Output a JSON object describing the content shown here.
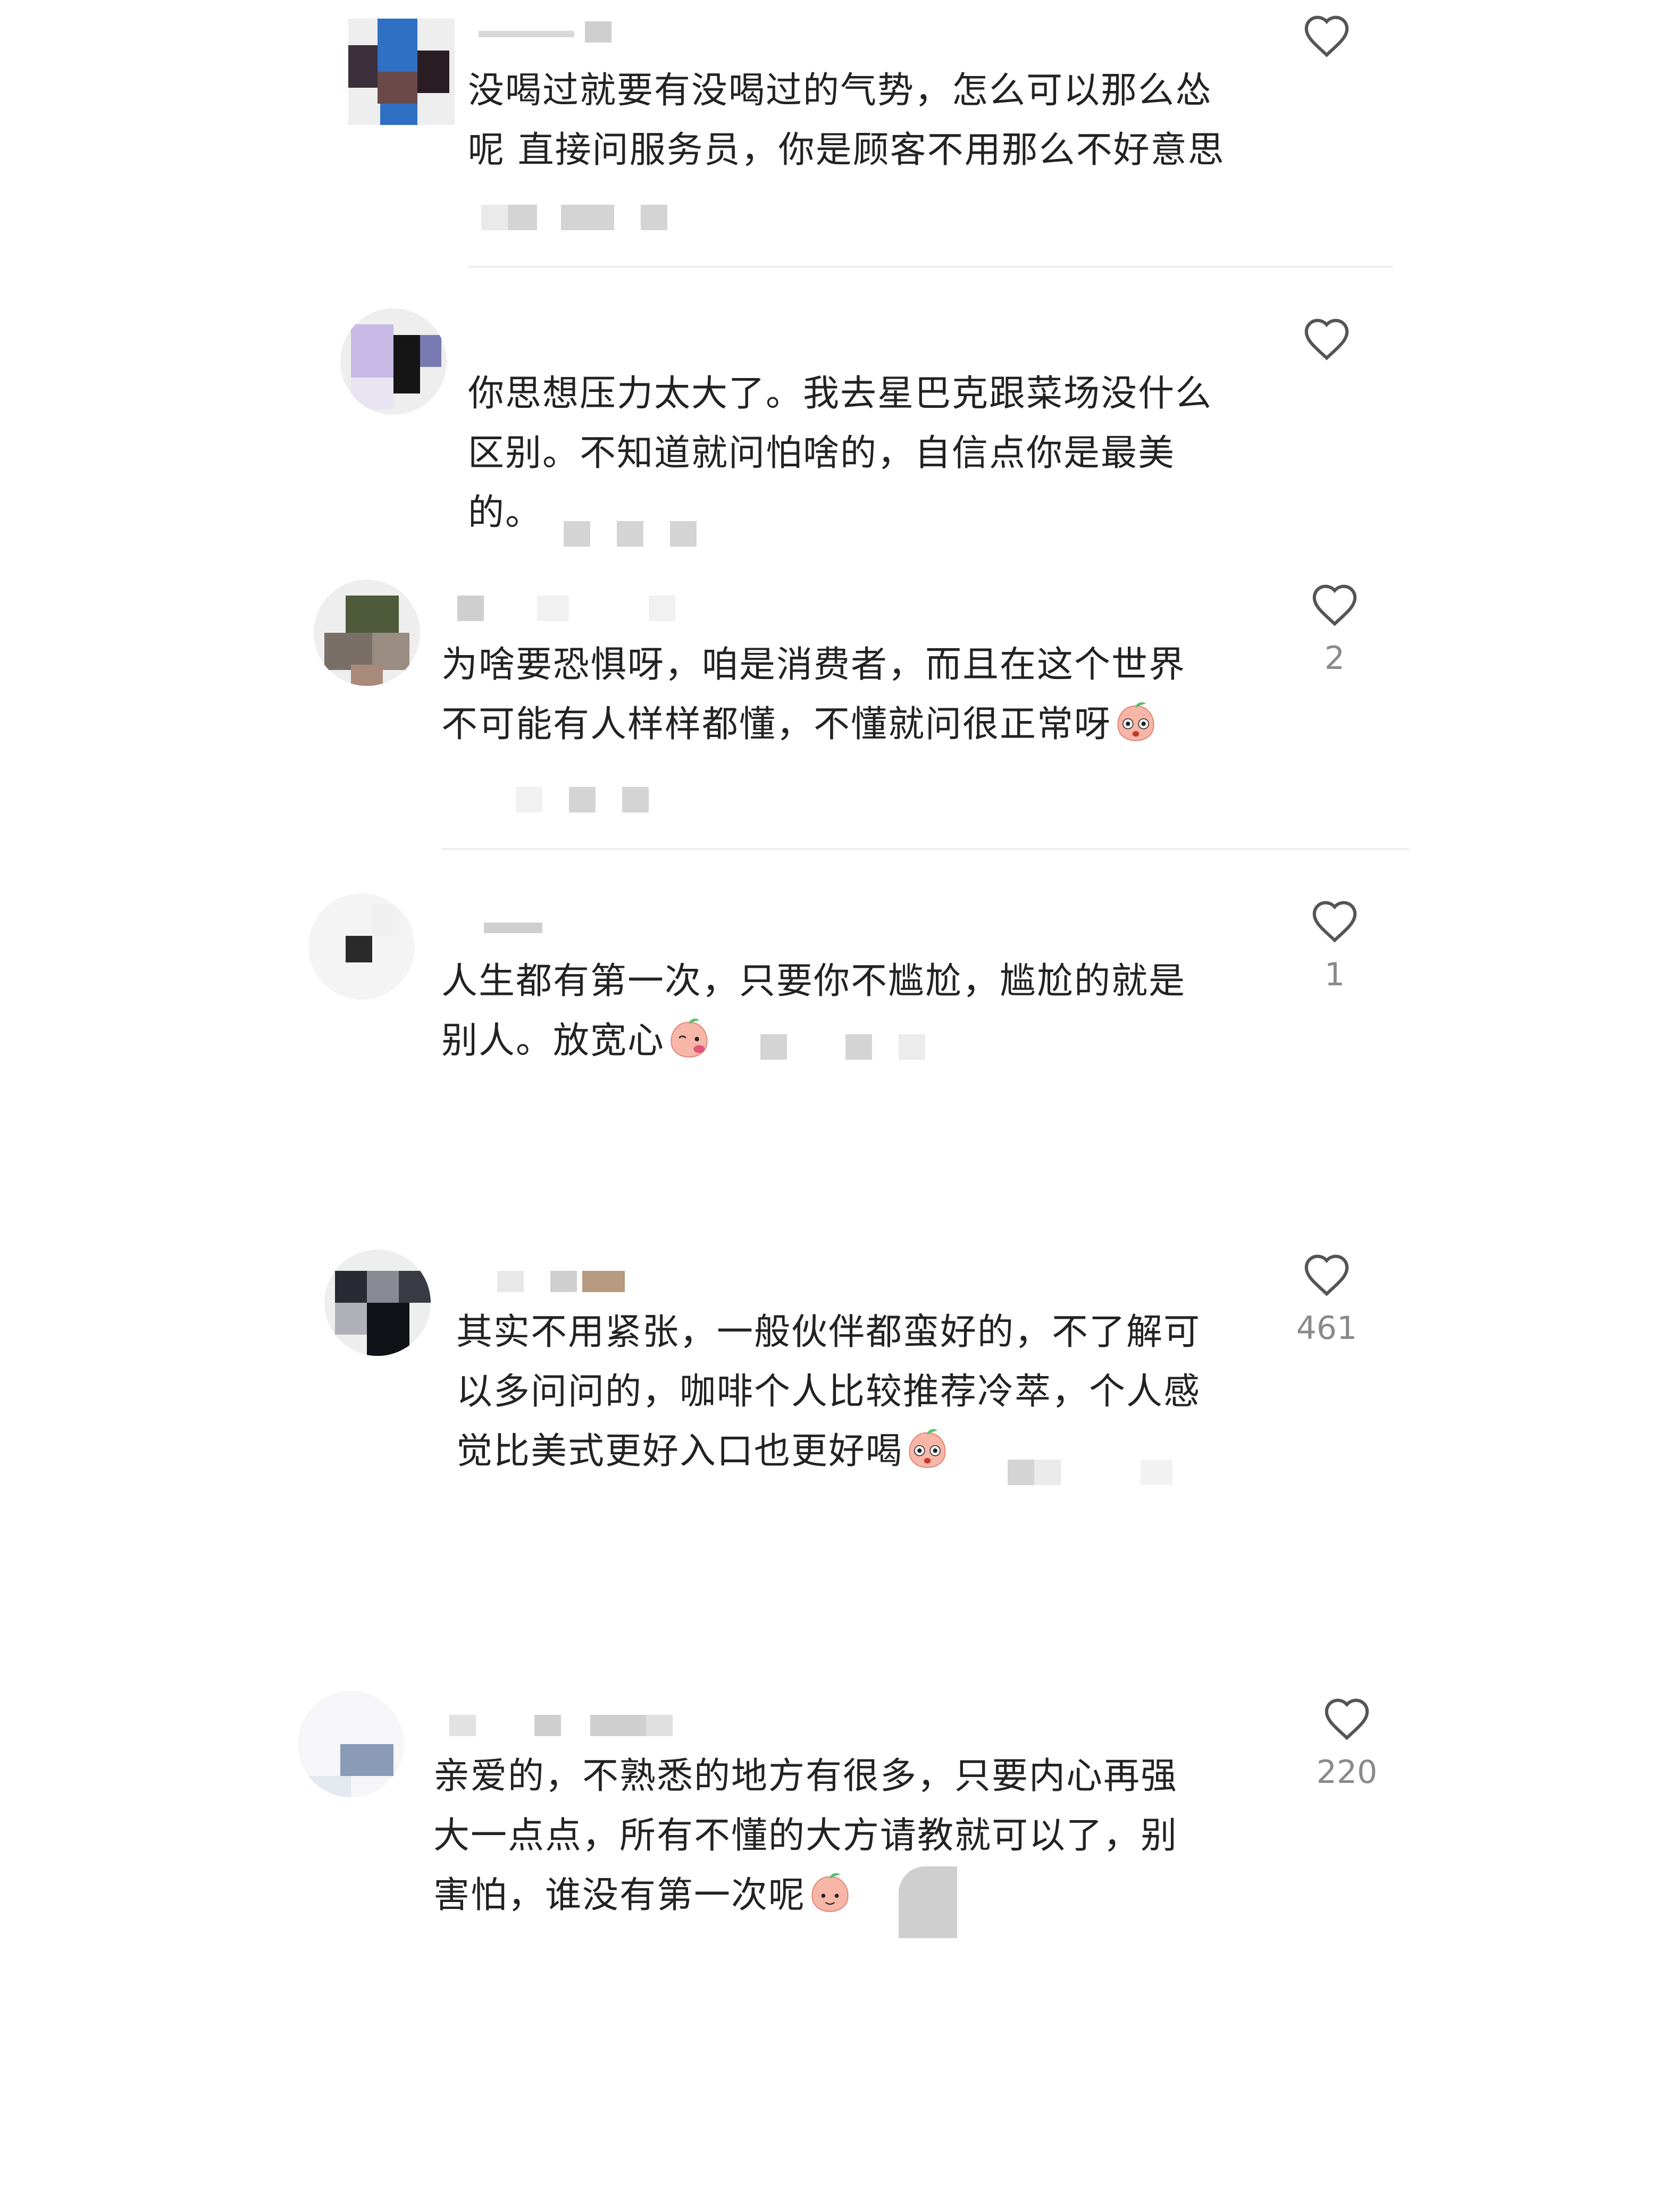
{
  "comments": [
    {
      "text": "没喝过就要有没喝过的气势，怎么可以那么怂\n呢 直接问服务员，你是顾客不用那么不好意思",
      "likes": ""
    },
    {
      "text": "你思想压力太大了。我去星巴克跟菜场没什么\n区别。不知道就问怕啥的，自信点你是最美\n的。",
      "likes": ""
    },
    {
      "text": "为啥要恐惧呀，咱是消费者，而且在这个世界\n不可能有人样样都懂，不懂就问很正常呀",
      "likes": "2"
    },
    {
      "text": "人生都有第一次，只要你不尴尬，尴尬的就是\n别人。放宽心",
      "likes": "1"
    },
    {
      "text": "其实不用紧张，一般伙伴都蛮好的，不了解可\n以多问问的，咖啡个人比较推荐冷萃，个人感\n觉比美式更好入口也更好喝",
      "likes": "461"
    },
    {
      "text": "亲爱的，不熟悉的地方有很多，只要内心再强\n大一点点，所有不懂的大方请教就可以了，别\n害怕，谁没有第一次呢",
      "likes": "220"
    }
  ],
  "icons": {
    "like": "heart-outline-icon",
    "emoji": "peach-face-emoji-icon"
  },
  "colors": {
    "text": "#222222",
    "like_count": "#8a8a8a",
    "divider": "#ececec"
  }
}
